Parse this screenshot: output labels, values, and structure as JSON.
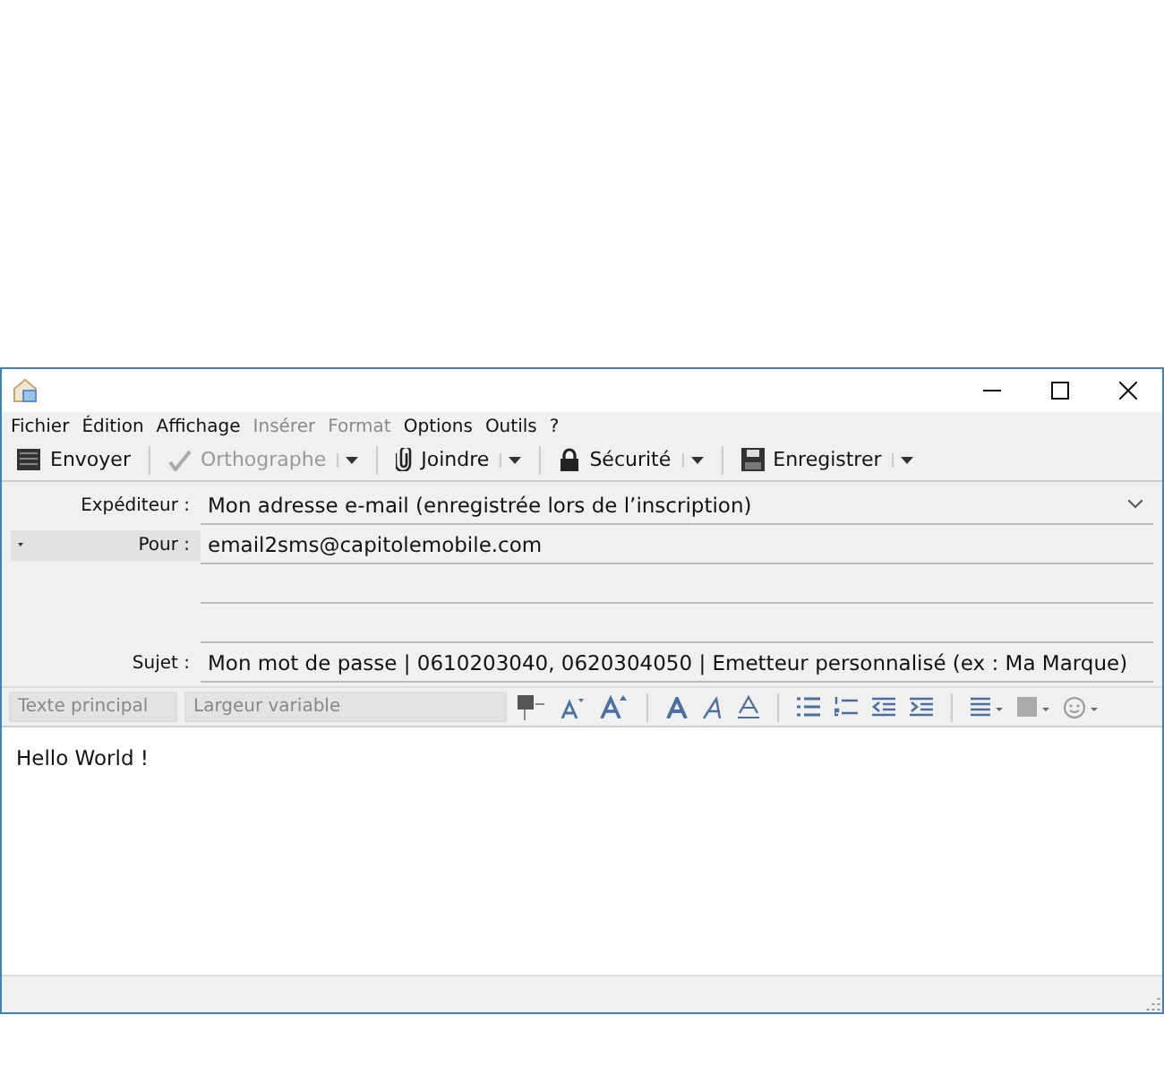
{
  "menu": [
    {
      "label": "Fichier",
      "disabled": false
    },
    {
      "label": "Édition",
      "disabled": false
    },
    {
      "label": "Affichage",
      "disabled": false
    },
    {
      "label": "Insérer",
      "disabled": true
    },
    {
      "label": "Format",
      "disabled": true
    },
    {
      "label": "Options",
      "disabled": false
    },
    {
      "label": "Outils",
      "disabled": false
    },
    {
      "label": "?",
      "disabled": false
    }
  ],
  "toolbar": [
    {
      "kind": "send",
      "label": "Envoyer",
      "disabled": false,
      "dropdown": false
    },
    {
      "kind": "spell",
      "label": "Orthographe",
      "disabled": true,
      "dropdown": true
    },
    {
      "kind": "attach",
      "label": "Joindre",
      "disabled": false,
      "dropdown": true
    },
    {
      "kind": "lock",
      "label": "Sécurité",
      "disabled": false,
      "dropdown": true
    },
    {
      "kind": "save",
      "label": "Enregistrer",
      "disabled": false,
      "dropdown": true
    }
  ],
  "fields": [
    {
      "kind": "select",
      "label": "Expéditeur :",
      "value": "Mon adresse e-mail (enregistrée lors de l’inscription)"
    },
    {
      "kind": "recipient",
      "label": "Pour :",
      "value": "email2sms@capitolemobile.com"
    },
    {
      "kind": "blank"
    },
    {
      "kind": "spacer"
    },
    {
      "kind": "text",
      "label": "Sujet :",
      "value": "Mon mot de passe | 0610203040, 0620304050 | Emetteur personnalisé (ex : Ma Marque)"
    }
  ],
  "format_bar": {
    "paragraph_style": "Texte principal",
    "font": "Largeur variable"
  },
  "body": "Hello World !"
}
